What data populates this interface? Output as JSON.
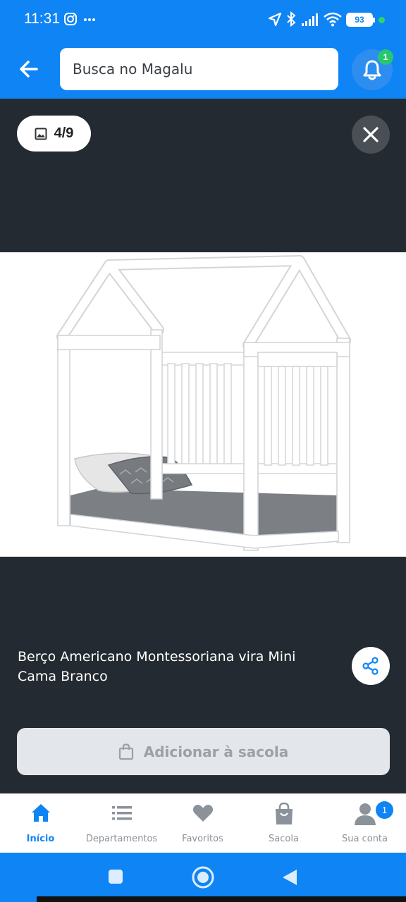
{
  "status_bar": {
    "time": "11:31",
    "battery": "93",
    "icons": [
      "instagram-icon",
      "more-icon",
      "location-icon",
      "bluetooth-icon",
      "signal-icon",
      "wifi-icon",
      "battery-icon"
    ]
  },
  "header": {
    "search_placeholder": "Busca no Magalu",
    "notification_count": "1"
  },
  "gallery": {
    "counter": "4/9",
    "image_description": "berco-montessoriano-branco"
  },
  "product": {
    "title": "Berço Americano Montessoriana vira Mini Cama Branco",
    "add_to_bag_label": "Adicionar à sacola"
  },
  "bottom_nav": {
    "items": [
      {
        "label": "Início",
        "icon": "home-icon",
        "active": true
      },
      {
        "label": "Departamentos",
        "icon": "list-icon",
        "active": false
      },
      {
        "label": "Favoritos",
        "icon": "heart-icon",
        "active": false
      },
      {
        "label": "Sacola",
        "icon": "bag-icon",
        "active": false
      },
      {
        "label": "Sua conta",
        "icon": "user-icon",
        "active": false
      }
    ],
    "account_badge": "1"
  },
  "colors": {
    "brand": "#0f84f5",
    "dark_bg": "#242a31",
    "badge_green": "#28c76f"
  }
}
